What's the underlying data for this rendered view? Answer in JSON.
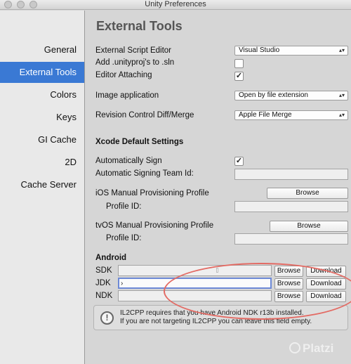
{
  "window": {
    "title": "Unity Preferences"
  },
  "sidebar": {
    "items": [
      {
        "label": "General"
      },
      {
        "label": "External Tools",
        "selected": true
      },
      {
        "label": "Colors"
      },
      {
        "label": "Keys"
      },
      {
        "label": "GI Cache"
      },
      {
        "label": "2D"
      },
      {
        "label": "Cache Server"
      }
    ]
  },
  "main": {
    "title": "External Tools",
    "external_script_editor": {
      "label": "External Script Editor",
      "value": "Visual Studio"
    },
    "add_unityproj": {
      "label": "Add .unityproj's to .sln",
      "checked": false
    },
    "editor_attaching": {
      "label": "Editor Attaching",
      "checked": true
    },
    "image_application": {
      "label": "Image application",
      "value": "Open by file extension"
    },
    "revision_control": {
      "label": "Revision Control Diff/Merge",
      "value": "Apple File Merge"
    },
    "xcode": {
      "heading": "Xcode Default Settings",
      "auto_sign": {
        "label": "Automatically Sign",
        "checked": true
      },
      "team_id": {
        "label": "Automatic Signing Team Id:",
        "value": ""
      },
      "ios_profile": {
        "label": "iOS Manual Provisioning Profile",
        "browse": "Browse",
        "profile_id_label": "Profile ID:"
      },
      "tvos_profile": {
        "label": "tvOS Manual Provisioning Profile",
        "browse": "Browse",
        "profile_id_label": "Profile ID:"
      }
    },
    "android": {
      "heading": "Android",
      "sdk": {
        "label": "SDK",
        "value": "",
        "browse": "Browse",
        "download": "Download"
      },
      "jdk": {
        "label": "JDK",
        "value": "",
        "browse": "Browse",
        "download": "Download"
      },
      "ndk": {
        "label": "NDK",
        "value": "",
        "browse": "Browse",
        "download": "Download"
      }
    },
    "info": {
      "icon": "!",
      "line1": "IL2CPP requires that you have Android NDK r13b installed.",
      "line2": "If you are not targeting IL2CPP you can leave this field empty."
    }
  },
  "icons": {
    "dropdown": "up-down-arrows-icon",
    "check": "checkmark-icon",
    "info": "exclamation-circle-icon"
  },
  "colors": {
    "selection": "#3a79d4",
    "annotation": "#e36a63",
    "focus": "#6d89d6"
  },
  "watermark": {
    "text": "Platzi"
  }
}
